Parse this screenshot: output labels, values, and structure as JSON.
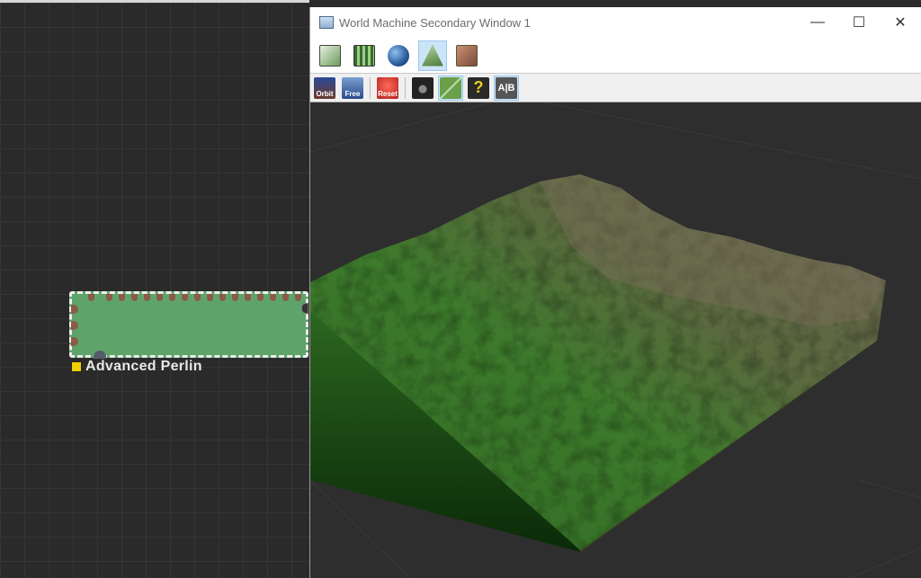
{
  "graph": {
    "node": {
      "label": "Advanced Perlin"
    }
  },
  "window": {
    "title": "World Machine Secondary Window 1",
    "controls": {
      "minimize": "—",
      "maximize": "☐",
      "close": "✕"
    }
  },
  "toolbar1": {
    "items": [
      {
        "name": "layout-view-icon"
      },
      {
        "name": "tile-view-icon"
      },
      {
        "name": "globe-view-icon"
      },
      {
        "name": "3d-view-icon",
        "active": true
      },
      {
        "name": "texture-view-icon"
      }
    ]
  },
  "toolbar2": {
    "items": [
      {
        "name": "orbit-icon",
        "label": "Orbit"
      },
      {
        "name": "free-icon",
        "label": "Free"
      },
      {
        "name": "reset-icon",
        "label": "Reset"
      },
      {
        "name": "camera-icon"
      },
      {
        "name": "wireframe-icon",
        "active": true
      },
      {
        "name": "help-icon"
      },
      {
        "name": "ab-compare-icon",
        "label": "A|B",
        "active": true
      }
    ]
  }
}
